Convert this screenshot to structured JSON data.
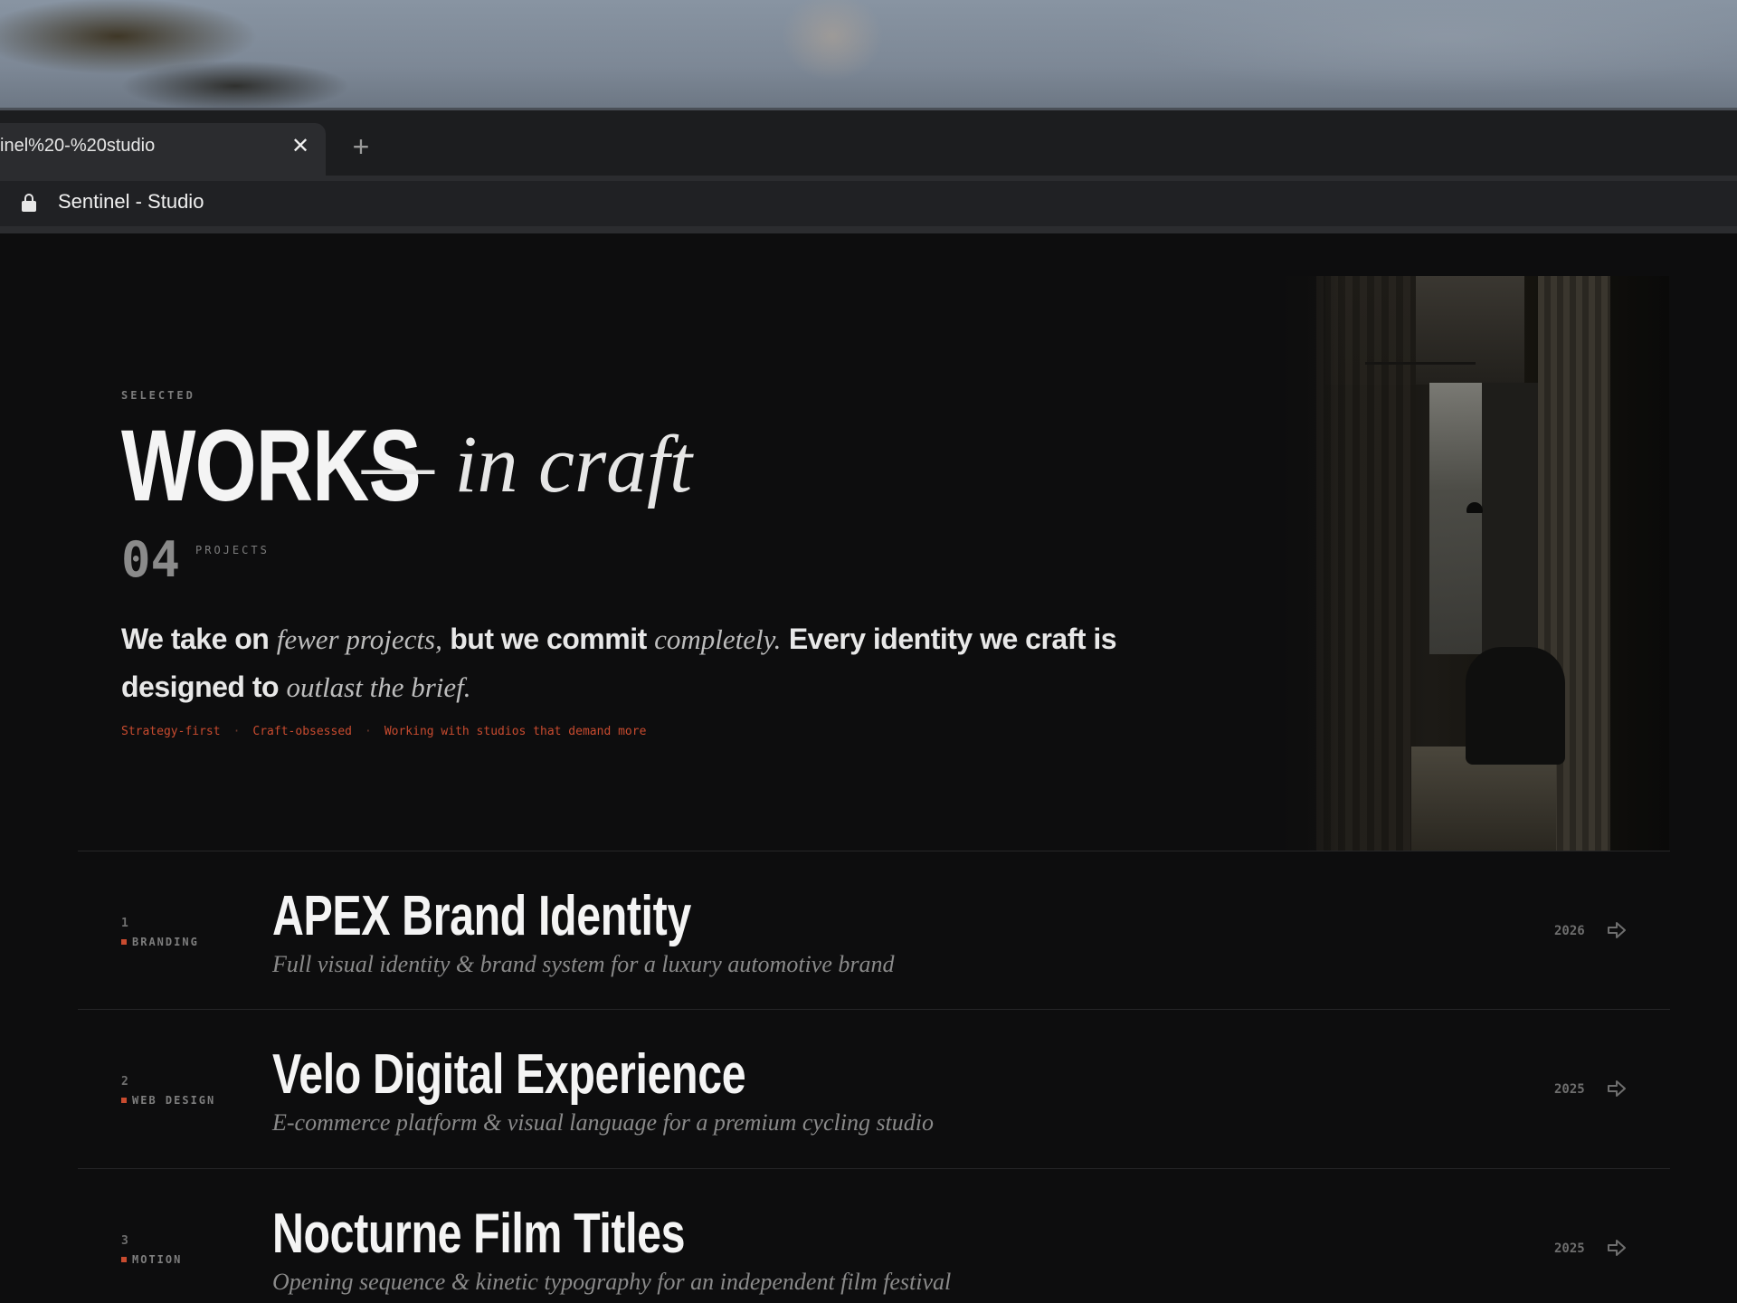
{
  "browser": {
    "tab_title": "inel%20-%20studio",
    "close_glyph": "✕",
    "new_tab_glyph": "+",
    "address_text": "Sentinel - Studio"
  },
  "hero": {
    "eyebrow": "SELECTED",
    "title_bold": "WORKS",
    "title_italic": "— in craft",
    "count": "04",
    "count_label": "PROJECTS",
    "lead": [
      {
        "text": "We take on ",
        "style": "sans"
      },
      {
        "text": "fewer projects,",
        "style": "serif"
      },
      {
        "text": " but we commit ",
        "style": "sans"
      },
      {
        "text": "completely.",
        "style": "serif"
      },
      {
        "text": " Every identity we craft is designed to ",
        "style": "sans"
      },
      {
        "text": "outlast the brief.",
        "style": "serif"
      }
    ],
    "tags": [
      "Strategy-first",
      "Craft-obsessed",
      "Working with studios that demand more"
    ],
    "tag_separator": "·"
  },
  "projects": [
    {
      "number": "1",
      "category": "BRANDING",
      "title": "APEX Brand Identity",
      "description": "Full visual identity & brand system for a luxury automotive brand",
      "year": "2026"
    },
    {
      "number": "2",
      "category": "WEB DESIGN",
      "title": "Velo Digital Experience",
      "description": "E-commerce platform & visual language for a premium cycling studio",
      "year": "2025"
    },
    {
      "number": "3",
      "category": "MOTION",
      "title": "Nocturne Film Titles",
      "description": "Opening sequence & kinetic typography for an independent film festival",
      "year": "2025"
    }
  ],
  "colors": {
    "accent": "#c84b2f",
    "background": "#0d0d0e",
    "text": "#f4f4f4"
  },
  "icons": {
    "lock": "lock-icon",
    "close": "close-icon",
    "add": "plus-icon",
    "arrow": "arrow-right-icon"
  }
}
